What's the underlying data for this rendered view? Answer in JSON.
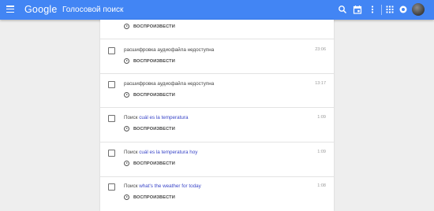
{
  "header": {
    "brand": "Google",
    "product": "Голосовой поиск",
    "icons": [
      "menu-icon",
      "search-icon",
      "calendar-icon",
      "more-vert-icon",
      "apps-icon",
      "notifications-icon"
    ],
    "color": "#4285f4"
  },
  "list": {
    "play_label": "ВОСПРОИЗВЕСТИ",
    "items": [
      {
        "title": "",
        "query": "",
        "time": ""
      },
      {
        "title": "расшифровка аудиофайла недоступна",
        "query": "",
        "time": "23:06"
      },
      {
        "title": "расшифровка аудиофайла недоступна",
        "query": "",
        "time": "13:17"
      },
      {
        "title": "Поиск ",
        "query": "cuál es la temperatura",
        "time": "1:09"
      },
      {
        "title": "Поиск ",
        "query": "cuál es la temperatura hoy",
        "time": "1:09"
      },
      {
        "title": "Поиск ",
        "query": "what's the weather for today",
        "time": "1:08"
      }
    ]
  }
}
